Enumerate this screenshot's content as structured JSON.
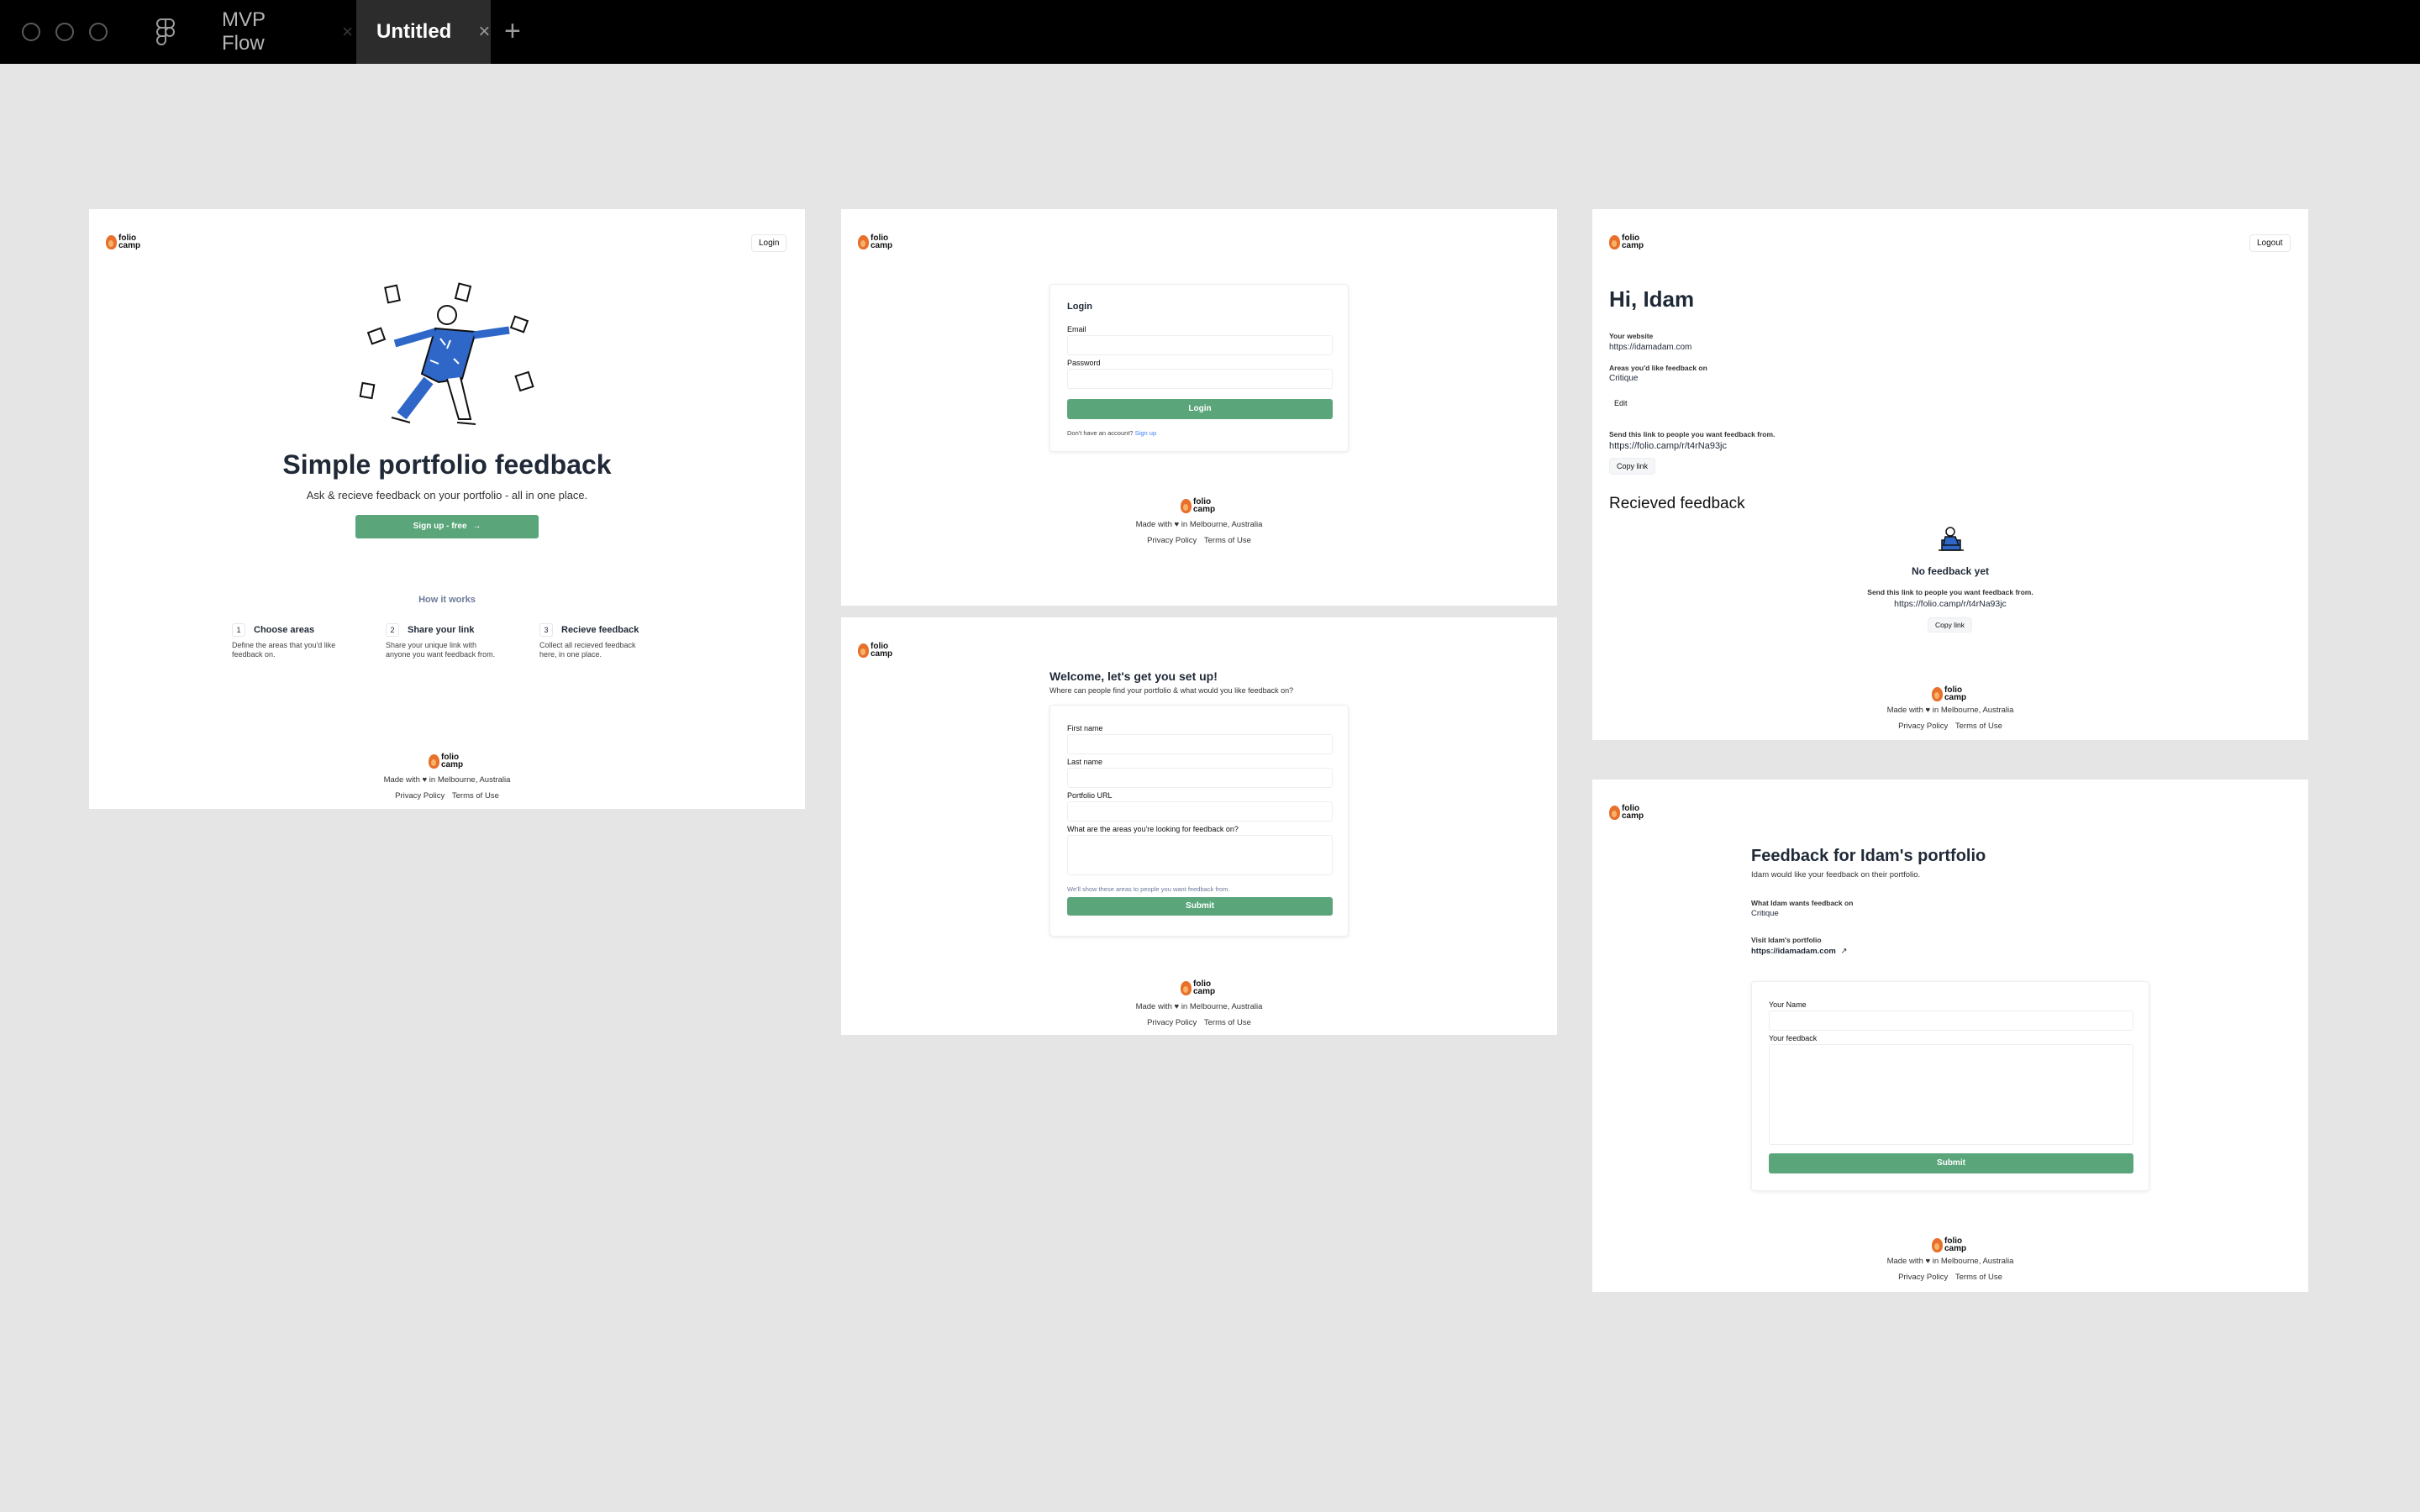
{
  "app": {
    "tabs": [
      {
        "label": "MVP Flow",
        "active": false
      },
      {
        "label": "Untitled",
        "active": true
      }
    ],
    "close_glyph": "×",
    "new_tab_glyph": "+"
  },
  "brand": {
    "line1": "folio",
    "line2": "camp",
    "accent": "#e8702a",
    "green": "#5aa57a"
  },
  "footer": {
    "made_prefix": "Made with",
    "made_suffix": "in Melbourne, Australia",
    "heart": "♥",
    "privacy": "Privacy Policy",
    "terms": "Terms of Use"
  },
  "landing": {
    "login": "Login",
    "headline": "Simple portfolio feedback",
    "subhead": "Ask & recieve feedback on your portfolio - all in one place.",
    "cta": "Sign up - free",
    "cta_arrow": "→",
    "how_title": "How it works",
    "steps": [
      {
        "num": "1",
        "title": "Choose areas",
        "desc1": "Define the areas that you'd like",
        "desc2": "feedback on."
      },
      {
        "num": "2",
        "title": "Share your link",
        "desc1": "Share your unique link with",
        "desc2": "anyone you want feedback from."
      },
      {
        "num": "3",
        "title": "Recieve feedback",
        "desc1": "Collect all recieved feedback",
        "desc2": "here, in one place."
      }
    ]
  },
  "login": {
    "title": "Login",
    "email_label": "Email",
    "password_label": "Password",
    "submit": "Login",
    "no_account": "Don't have an account?",
    "signup": "Sign up"
  },
  "setup": {
    "title": "Welcome, let's get you set up!",
    "subtitle": "Where can people find your portfolio & what would you like feedback on?",
    "first_name": "First name",
    "last_name": "Last name",
    "portfolio_url": "Portfolio URL",
    "areas_q": "What are the areas you're looking for feedback on?",
    "hint": "We'll show these areas to people you want feedback from.",
    "submit": "Submit"
  },
  "dashboard": {
    "logout": "Logout",
    "greeting": "Hi, Idam",
    "website_label": "Your website",
    "website": "https://idamadam.com",
    "areas_label": "Areas you'd like feedback on",
    "areas": "Critique",
    "edit": "Edit",
    "send_label": "Send this link to people you want feedback from.",
    "link": "https://folio.camp/r/t4rNa93jc",
    "copy": "Copy link",
    "received_title": "Recieved feedback",
    "empty_title": "No feedback yet",
    "empty_send": "Send this link to people you want feedback from.",
    "empty_link": "https://folio.camp/r/t4rNa93jc",
    "empty_copy": "Copy link"
  },
  "feedback": {
    "title": "Feedback for Idam's portfolio",
    "subtitle": "Idam would like your feedback on their portfolio.",
    "wants_label": "What Idam wants feedback on",
    "wants": "Critique",
    "visit_label": "Visit Idam's portfolio",
    "visit_url": "https://idamadam.com",
    "external_icon": "↗",
    "name_label": "Your Name",
    "feedback_label": "Your feedback",
    "submit": "Submit"
  }
}
